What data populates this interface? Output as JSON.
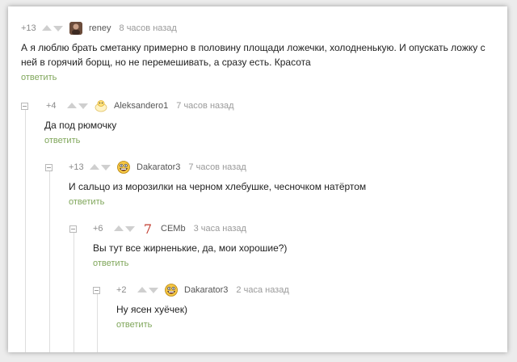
{
  "comments": [
    {
      "score": "+13",
      "user": "reney",
      "time": "8 часов назад",
      "text": "А я люблю брать сметанку примерно в половину площади ложечки, холодненькую. И опускать ложку с ней в горячий борщ, но не перемешивать, а сразу есть. Красота",
      "reply": "ответить",
      "avatar_icon": "photo-avatar-icon"
    },
    {
      "score": "+4",
      "user": "Aleksandero1",
      "time": "7 часов назад",
      "text": "Да под рюмочку",
      "reply": "ответить",
      "avatar_icon": "egg-avatar-icon"
    },
    {
      "score": "+13",
      "user": "Dakarator3",
      "time": "7 часов назад",
      "text": "И сальцо из морозилки на черном хлебушке, чесночком натёртом",
      "reply": "ответить",
      "avatar_icon": "troll-face-avatar-icon"
    },
    {
      "score": "+6",
      "user": "CEMb",
      "time": "3 часа назад",
      "text": "Вы тут все жирненькие, да, мои хорошие?)",
      "reply": "ответить",
      "avatar_icon": "seven-avatar-icon"
    },
    {
      "score": "+2",
      "user": "Dakarator3",
      "time": "2 часа назад",
      "text": "Ну ясен хуёчек)",
      "reply": "ответить",
      "avatar_icon": "troll-face-avatar-icon"
    }
  ],
  "colors": {
    "reply_link": "#7fa65a",
    "meta_text": "#9a9a9a",
    "body_text": "#222222",
    "avatar_seven": "#c0392b"
  }
}
